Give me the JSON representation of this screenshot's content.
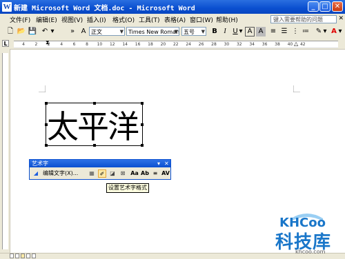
{
  "window": {
    "title": "新建 Microsoft Word 文档.doc - Microsoft Word",
    "app_icon": "W"
  },
  "menu": {
    "items": [
      "文件(F)",
      "编辑(E)",
      "视图(V)",
      "插入(I)",
      "格式(O)",
      "工具(T)",
      "表格(A)",
      "窗口(W)",
      "帮助(H)"
    ],
    "help_placeholder": "键入需要帮助的问题"
  },
  "toolbar": {
    "style_value": "正文",
    "font_value": "Times New Roman",
    "size_value": "五号",
    "bold_label": "B",
    "italic_label": "I",
    "underline_label": "U",
    "char_border_label": "A",
    "char_shade_label": "A",
    "font_color_label": "A"
  },
  "ruler": {
    "corner_label": "L",
    "ticks": [
      "4",
      "2",
      "2",
      "4",
      "6",
      "8",
      "10",
      "12",
      "14",
      "16",
      "18",
      "20",
      "22",
      "24",
      "26",
      "28",
      "30",
      "32",
      "34",
      "36",
      "38",
      "40",
      "42"
    ]
  },
  "document": {
    "wordart_text": "太平洋"
  },
  "wordart_toolbar": {
    "title": "艺术字",
    "edit_text_label": "编辑文字(X)...",
    "dropdown_glyph": "▾",
    "close_glyph": "✕",
    "tooltip": "设置艺术字格式"
  },
  "watermark": {
    "brand": "科技库",
    "logo_text": "KHCoo",
    "url": "khcoo.com"
  },
  "colors": {
    "title_bar": "#0a4fd0",
    "chrome": "#ece9d8",
    "brand_blue": "#1976c9",
    "font_color_red": "#e00000"
  }
}
